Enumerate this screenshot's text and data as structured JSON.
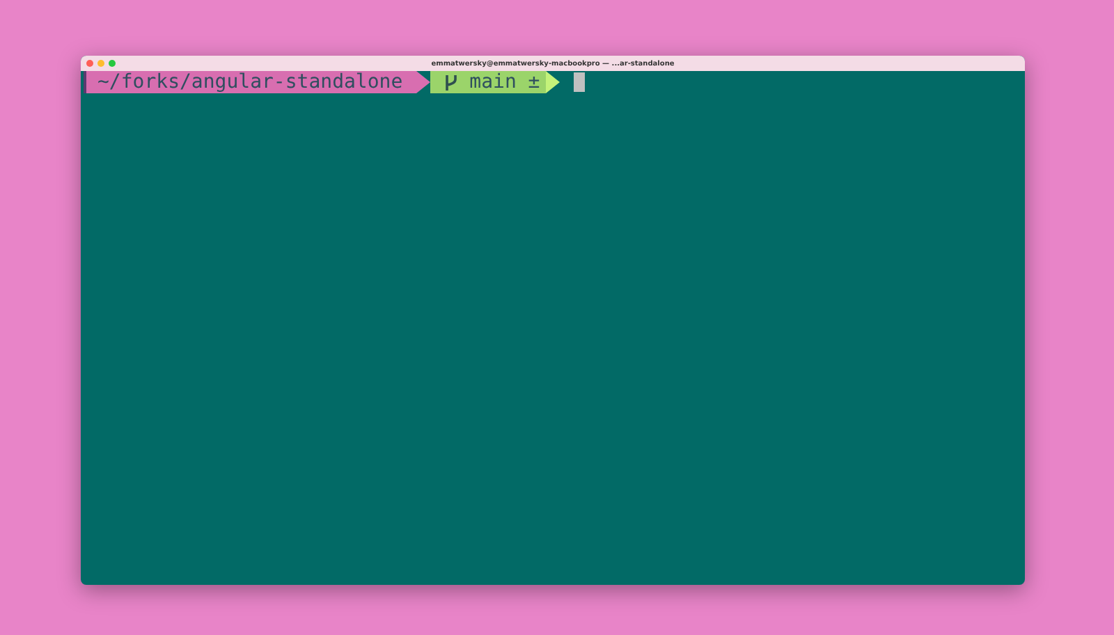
{
  "window": {
    "title": "emmatwersky@emmatwersky-macbookpro — ...ar-standalone"
  },
  "prompt": {
    "path": "~/forks/angular-standalone",
    "branch": "main ±"
  }
}
